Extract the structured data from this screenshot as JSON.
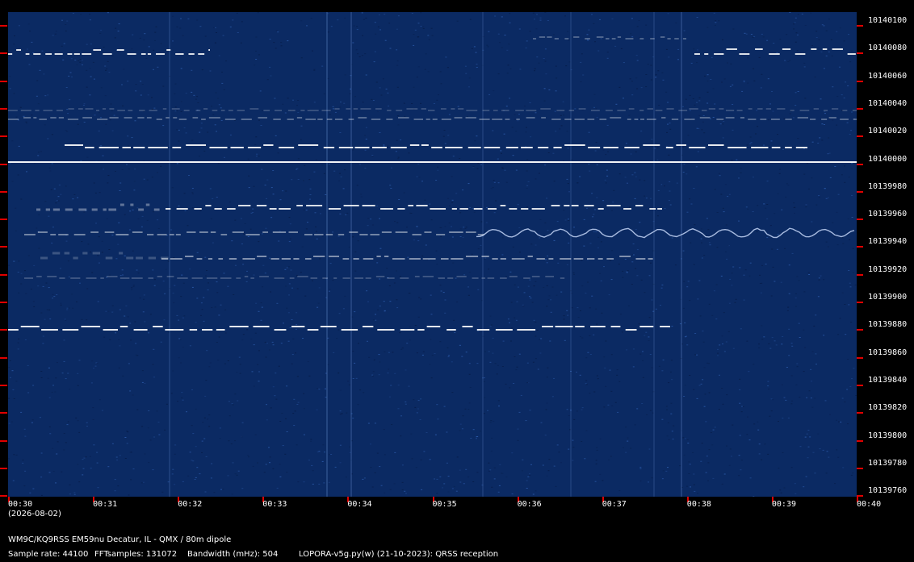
{
  "display": {
    "freq_labels": [
      "10140100",
      "10140080",
      "10140060",
      "10140040",
      "10140020",
      "10140000",
      "10139980",
      "10139960",
      "10139940",
      "10139920",
      "10139900",
      "10139880",
      "10139860",
      "10139840",
      "10139820",
      "10139800",
      "10139780",
      "10139760"
    ],
    "time_labels": [
      "00:30",
      "00:31",
      "00:32",
      "00:33",
      "00:34",
      "00:35",
      "00:36",
      "00:37",
      "00:38",
      "00:39",
      "00:40"
    ],
    "date": "(2026-08-02)",
    "station": "WM9C/KQ9RSS EM59nu Decatur, IL - QMX / 80m dipole",
    "sample_rate": "Sample rate: 44100",
    "fft_samples": "FFTsamples: 131072",
    "bandwidth": "Bandwidth (mHz): 504",
    "software": "LOPORA-v5g.py(w) (21-10-2023): QRSS reception"
  },
  "colors": {
    "background": "#000000",
    "waterfall": "#0b2a63",
    "signal": "#ffffff",
    "tick": "#e00000"
  }
}
